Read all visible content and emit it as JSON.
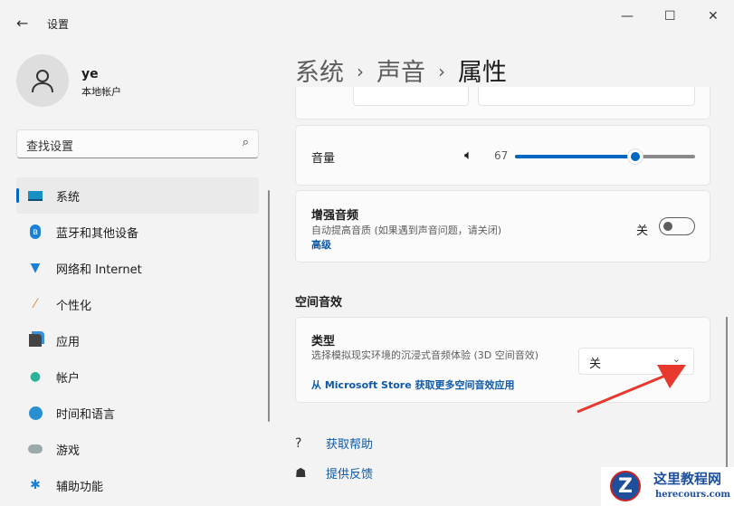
{
  "app": {
    "title": "设置",
    "back_icon": "arrow-left-icon"
  },
  "window": {
    "minimize": "—",
    "maximize": "☐",
    "close": "✕"
  },
  "user": {
    "name": "ye",
    "type": "本地帐户"
  },
  "search": {
    "placeholder": "查找设置"
  },
  "nav": [
    {
      "label": "系统",
      "icon": "monitor-icon",
      "selected": true
    },
    {
      "label": "蓝牙和其他设备",
      "icon": "bluetooth-icon"
    },
    {
      "label": "网络和 Internet",
      "icon": "wifi-icon"
    },
    {
      "label": "个性化",
      "icon": "brush-icon"
    },
    {
      "label": "应用",
      "icon": "apps-icon"
    },
    {
      "label": "帐户",
      "icon": "person-icon"
    },
    {
      "label": "时间和语言",
      "icon": "clock-globe-icon"
    },
    {
      "label": "游戏",
      "icon": "gamepad-icon"
    },
    {
      "label": "辅助功能",
      "icon": "accessibility-icon"
    }
  ],
  "breadcrumb": [
    "系统",
    "声音",
    "属性"
  ],
  "volume": {
    "label": "音量",
    "value": "67",
    "percent": 67
  },
  "enhance": {
    "title": "增强音频",
    "desc": "自动提高音质 (如果遇到声音问题，请关闭)",
    "link": "高级",
    "state": "关"
  },
  "spatial": {
    "heading": "空间音效",
    "title": "类型",
    "desc": "选择模拟现实环境的沉浸式音频体验 (3D 空间音效)",
    "link": "从 Microsoft Store 获取更多空间音效应用",
    "value": "关"
  },
  "help": {
    "get_help": "获取帮助",
    "feedback": "提供反馈"
  },
  "watermark": {
    "name": "这里教程网",
    "url": "herecours.com"
  },
  "colors": {
    "accent": "#0067c0",
    "arrow": "#e8392f"
  }
}
